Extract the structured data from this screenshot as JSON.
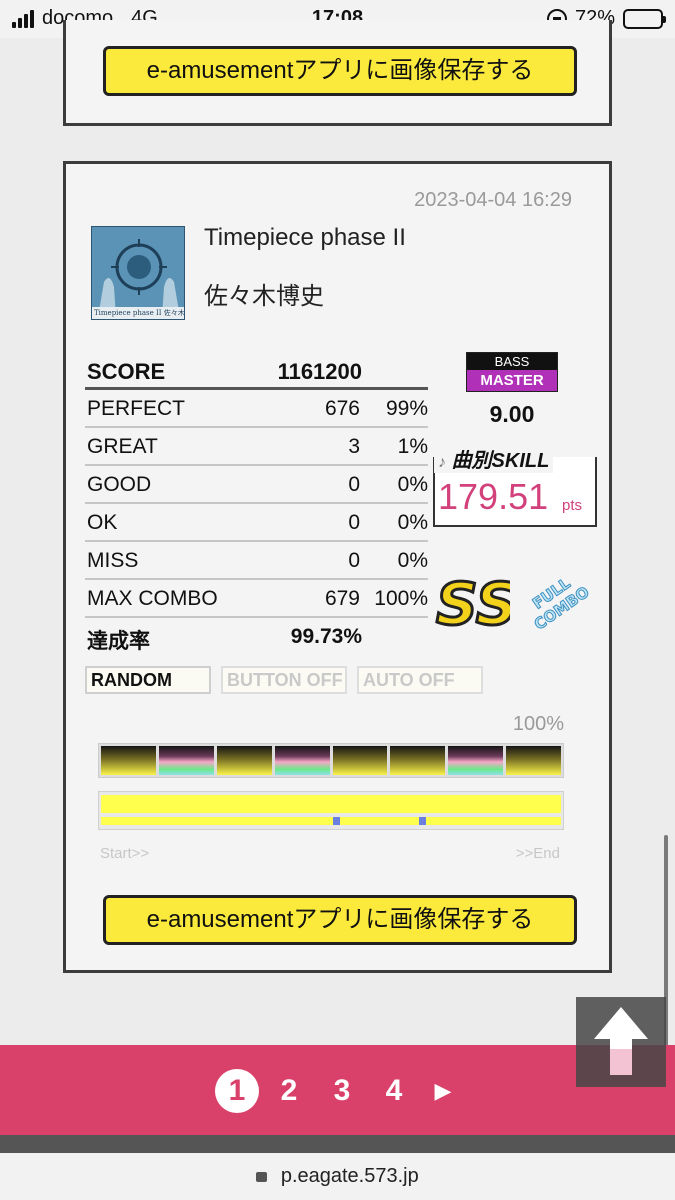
{
  "status": {
    "carrier": "docomo",
    "network": "4G",
    "time": "17:08",
    "battery": "72%",
    "battery_level": 0.72
  },
  "save_button_label": "e-amusementアプリに画像保存する",
  "result": {
    "date": "2023-04-04 16:29",
    "song_title": "Timepiece phase II",
    "artist": "佐々木博史",
    "jacket_caption": "Timepiece phase II 佐々木博史",
    "score": {
      "label": "SCORE",
      "value": "1161200"
    },
    "judgements": [
      {
        "label": "PERFECT",
        "count": "676",
        "pct": "99%"
      },
      {
        "label": "GREAT",
        "count": "3",
        "pct": "1%"
      },
      {
        "label": "GOOD",
        "count": "0",
        "pct": "0%"
      },
      {
        "label": "OK",
        "count": "0",
        "pct": "0%"
      },
      {
        "label": "MISS",
        "count": "0",
        "pct": "0%"
      },
      {
        "label": "MAX COMBO",
        "count": "679",
        "pct": "100%"
      }
    ],
    "achievement": {
      "label": "達成率",
      "value": "99.73%"
    },
    "part": "BASS",
    "difficulty": "MASTER",
    "level": "9.00",
    "skill_label": "曲別SKILL",
    "skill_value": "179.51",
    "skill_unit": "pts",
    "rank": "SS",
    "combo_badge": "FULL COMBO",
    "options": [
      "RANDOM",
      "BUTTON OFF",
      "AUTO OFF"
    ],
    "progress_label": "100%",
    "progress": 1.0,
    "start_label": "Start>>",
    "end_label": ">>End"
  },
  "pagination": {
    "pages": [
      "1",
      "2",
      "3",
      "4"
    ],
    "current": "1",
    "next": "▶"
  },
  "url": "p.eagate.573.jp",
  "colors": {
    "accent_pink": "#d9406a",
    "button_yellow": "#fbea3c",
    "skill_pink": "#d2417c",
    "master_purple": "#b030b8"
  }
}
